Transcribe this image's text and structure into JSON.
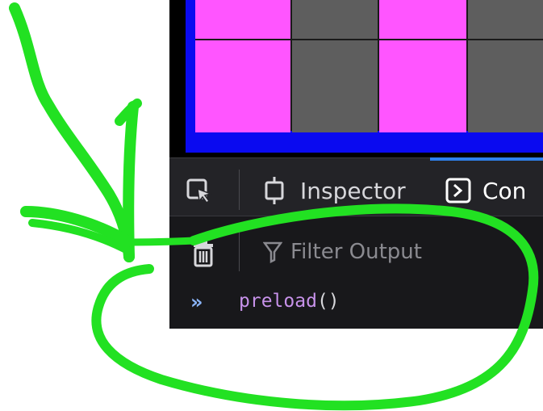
{
  "devtools": {
    "tabs": [
      {
        "label": "Inspector",
        "icon": "inspector-icon"
      },
      {
        "label": "Con",
        "icon": "console-icon"
      }
    ],
    "filter": {
      "placeholder": "Filter Output",
      "icon": "filter-icon"
    },
    "console_input": {
      "prompt": "»",
      "fn": "preload",
      "punct": "()"
    }
  },
  "game": {
    "colors": {
      "border": "#0a0af0",
      "pink": "#ff55ff",
      "gray": "#5e5e5e"
    }
  },
  "annotation": {
    "color": "#22e122"
  }
}
